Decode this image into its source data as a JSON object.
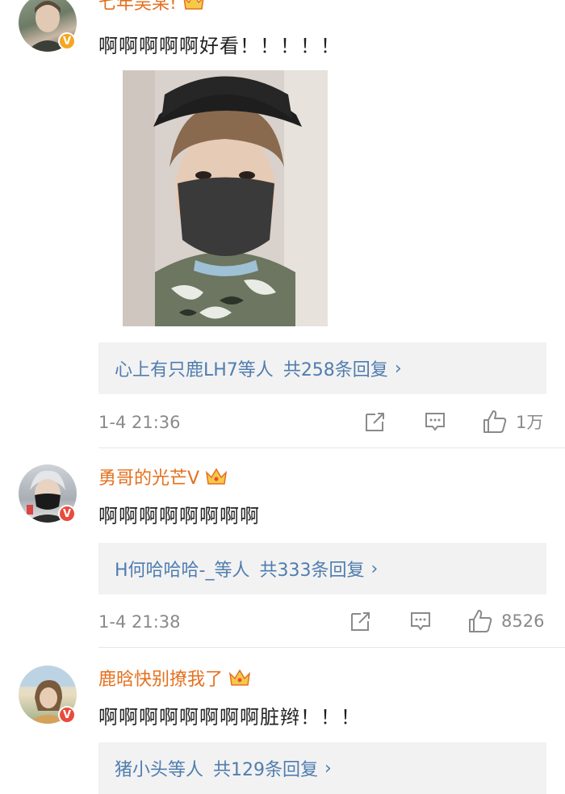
{
  "comments": [
    {
      "username": "七年吴某!",
      "text": "啊啊啊啊啊好看！！！！！",
      "replies_who": "心上有只鹿LH7等人",
      "replies_count": "共258条回复",
      "time": "1-4 21:36",
      "likes": "1万"
    },
    {
      "username": "勇哥的光芒V",
      "text": "啊啊啊啊啊啊啊啊",
      "replies_who": "H何哈哈哈-_等人",
      "replies_count": "共333条回复",
      "time": "1-4 21:38",
      "likes": "8526"
    },
    {
      "username": "鹿晗快别撩我了",
      "text": "啊啊啊啊啊啊啊啊脏辫！！！",
      "replies_who": "猪小头等人",
      "replies_count": "共129条回复",
      "time": "",
      "likes": ""
    }
  ],
  "icons": {
    "chevron": "›",
    "verified_badge": "V",
    "crown": "crown-icon",
    "share": "share-icon",
    "comment": "comment-icon",
    "like": "thumbs-up-icon"
  },
  "colors": {
    "username": "#e4701f",
    "reply_link": "#507daf",
    "badge_gold": "#f5a623",
    "badge_red": "#e94b3c",
    "meta_gray": "#8a8a8a"
  }
}
